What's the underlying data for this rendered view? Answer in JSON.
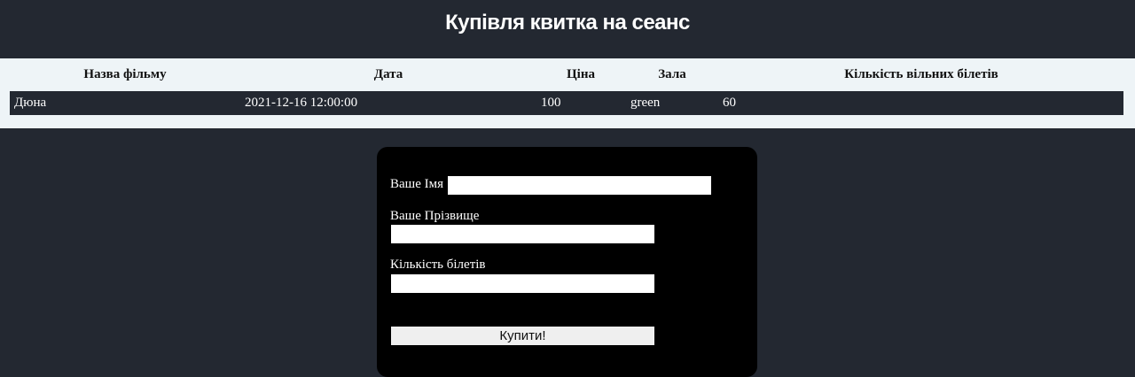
{
  "header": {
    "title": "Купівля квитка на сеанс"
  },
  "table": {
    "columns": [
      "Назва фільму",
      "Дата",
      "Ціна",
      "Зала",
      "Кількість вільних білетів"
    ],
    "rows": [
      {
        "film": "Дюна",
        "date": "2021-12-16 12:00:00",
        "price": "100",
        "hall": "green",
        "free_tickets": "60"
      }
    ]
  },
  "form": {
    "first_name_label": "Ваше Імя",
    "first_name_value": "",
    "last_name_label": "Ваше Прізвище",
    "last_name_value": "",
    "quantity_label": "Кількість білетів",
    "quantity_value": "",
    "submit_label": "Купити!"
  }
}
